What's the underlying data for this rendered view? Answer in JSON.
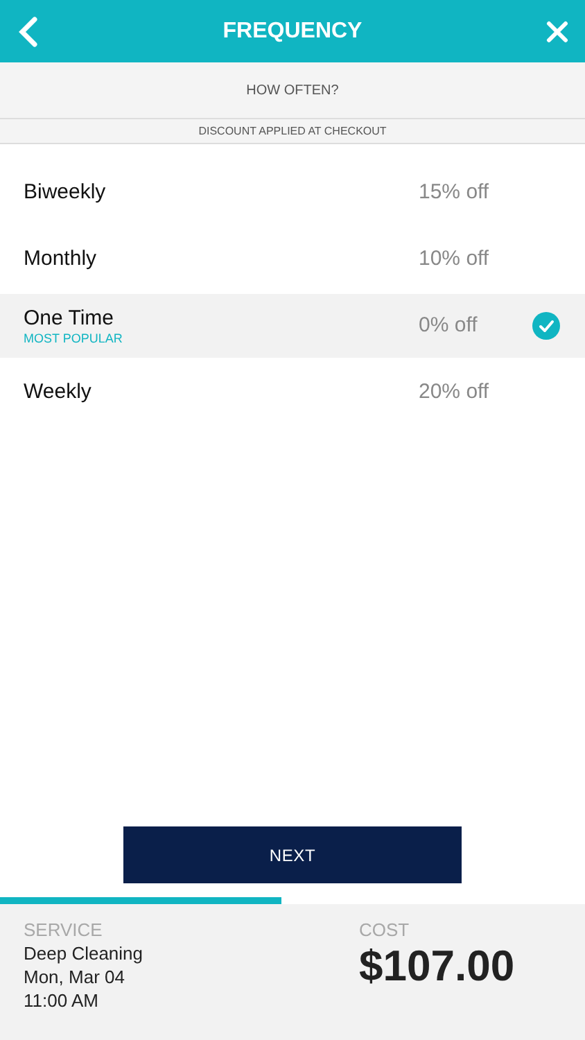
{
  "header": {
    "title": "FREQUENCY"
  },
  "subheader": "HOW OFTEN?",
  "notice": "DISCOUNT APPLIED AT CHECKOUT",
  "options": [
    {
      "label": "Biweekly",
      "discount": "15% off",
      "selected": false
    },
    {
      "label": "Monthly",
      "discount": "10% off",
      "selected": false
    },
    {
      "label": "One Time",
      "tag": "MOST POPULAR",
      "discount": "0% off",
      "selected": true
    },
    {
      "label": "Weekly",
      "discount": "20% off",
      "selected": false
    }
  ],
  "next_button": "NEXT",
  "progress": {
    "level": 0.48
  },
  "summary": {
    "service_label": "SERVICE",
    "service_lines": [
      "Deep Cleaning",
      "Mon, Mar 04",
      "11:00 AM"
    ],
    "cost_label": "COST",
    "cost": "$107.00"
  }
}
